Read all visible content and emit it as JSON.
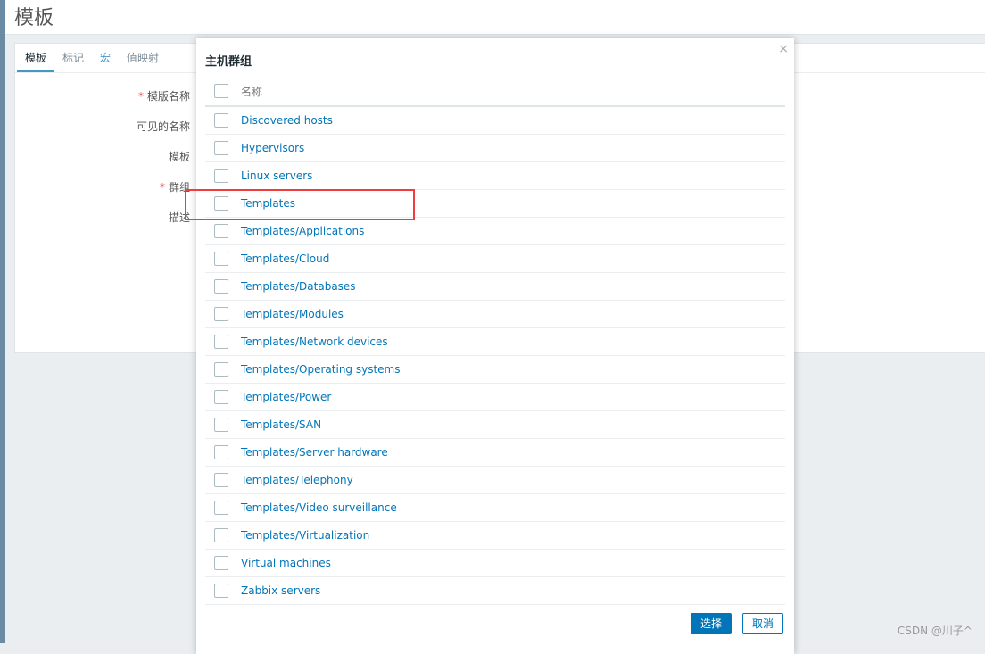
{
  "page": {
    "title": "模板"
  },
  "tabs": [
    {
      "label": "模板"
    },
    {
      "label": "标记"
    },
    {
      "label": "宏"
    },
    {
      "label": "值映射"
    }
  ],
  "form": {
    "labels": [
      {
        "label": "模版名称",
        "required": true
      },
      {
        "label": "可见的名称",
        "required": false
      },
      {
        "label": "模板",
        "required": false
      },
      {
        "label": "群组",
        "required": true
      },
      {
        "label": "描述",
        "required": false
      }
    ]
  },
  "modal": {
    "title": "主机群组",
    "close": "×",
    "column_header": "名称",
    "items": [
      "Discovered hosts",
      "Hypervisors",
      "Linux servers",
      "Templates",
      "Templates/Applications",
      "Templates/Cloud",
      "Templates/Databases",
      "Templates/Modules",
      "Templates/Network devices",
      "Templates/Operating systems",
      "Templates/Power",
      "Templates/SAN",
      "Templates/Server hardware",
      "Templates/Telephony",
      "Templates/Video surveillance",
      "Templates/Virtualization",
      "Virtual machines",
      "Zabbix servers"
    ],
    "select_label": "选择",
    "cancel_label": "取消",
    "highlighted_item": "Templates"
  },
  "watermark": "CSDN @川子^",
  "colors": {
    "accent": "#0275b8",
    "highlight_box": "#f03c3c"
  }
}
